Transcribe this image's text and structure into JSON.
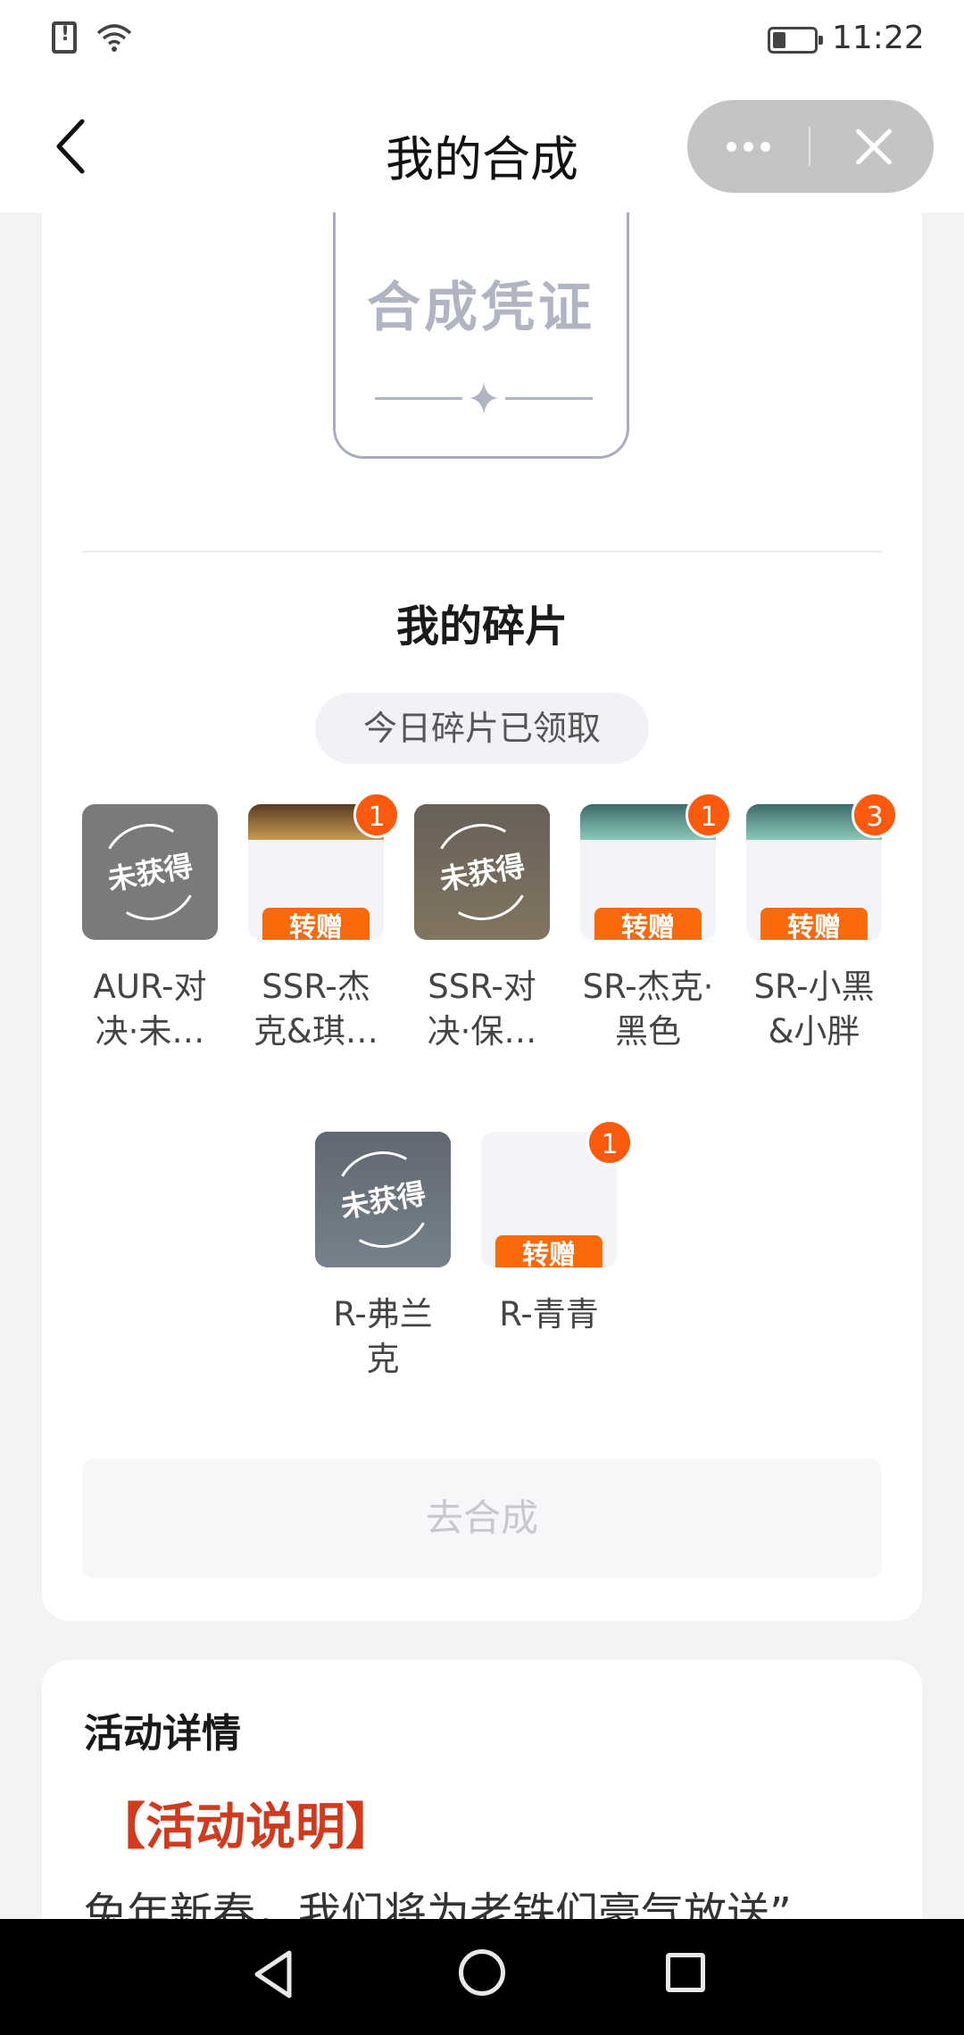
{
  "status_bar": {
    "time": "11:22"
  },
  "header": {
    "title": "我的合成"
  },
  "voucher": {
    "text": "合成凭证"
  },
  "fragments_section": {
    "title": "我的碎片",
    "daily_status": "今日碎片已领取",
    "locked_label": "未获得",
    "gift_label": "转赠",
    "items": [
      {
        "name_l1": "AUR-对",
        "name_l2": "决·未…",
        "badge": "",
        "locked": true
      },
      {
        "name_l1": "SSR-杰",
        "name_l2": "克&琪…",
        "badge": "1",
        "locked": false
      },
      {
        "name_l1": "SSR-对",
        "name_l2": "决·保…",
        "badge": "",
        "locked": true
      },
      {
        "name_l1": "SR-杰克·",
        "name_l2": "黑色",
        "badge": "1",
        "locked": false
      },
      {
        "name_l1": "SR-小黑",
        "name_l2": "&小胖",
        "badge": "3",
        "locked": false
      },
      {
        "name_l1": "R-弗兰",
        "name_l2": "克",
        "badge": "",
        "locked": true
      },
      {
        "name_l1": "R-青青",
        "name_l2": "",
        "badge": "1",
        "locked": false
      }
    ],
    "synthesize_button": "去合成"
  },
  "details": {
    "title": "活动详情",
    "subtitle": "【活动说明】",
    "paragraph": "兔年新春，我们将为老铁们豪气放送”"
  }
}
